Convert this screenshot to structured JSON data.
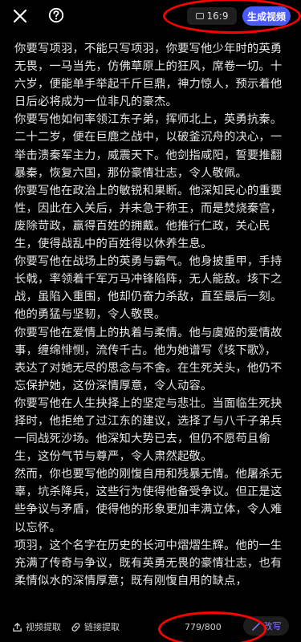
{
  "header": {
    "aspect_ratio": "16:9",
    "generate_label": "生成视频"
  },
  "editor": {
    "content": "你要写项羽，不能只写项羽，你要写他少年时的英勇无畏，一马当先，仿佛草原上的狂风，席卷一切。十六岁，便能单手举起千斤巨鼎，神力惊人，预示着他日后必将成为一位非凡的豪杰。\n你要写他如何率领江东子弟，挥师北上，英勇抗秦。二十二岁，便在巨鹿之战中，以破釜沉舟的决心，一举击溃秦军主力，威震天下。他剑指咸阳，誓要推翻暴秦，恢复六国，那份豪情壮志，令人敬佩。\n你要写他在政治上的敏锐和果断。他深知民心的重要性，因此在入关后，并未急于称王，而是焚烧秦宫，废除苛政，赢得百姓的拥戴。他推行仁政，关心民生，使得战乱中的百姓得以休养生息。\n你要写他在战场上的英勇与霸气。他身披重甲，手持长戟，率领着千军万马冲锋陷阵，无人能敌。垓下之战，虽陷入重围，他却仍奋力杀敌，直至最后一刻。他的勇猛与坚韧，令人敬畏。\n你要写他在爱情上的执着与柔情。他与虞姬的爱情故事，缠绵悱恻，流传千古。他为她谱写《垓下歌》，表达了对她无尽的思念与不舍。在生死关头，他仍不忘保护她，这份深情厚意，令人动容。\n你要写他在人生抉择上的坚定与悲壮。当面临生死抉择时，他拒绝了过江东的建议，选择了与八千子弟兵一同战死沙场。他深知大势已去，但仍不愿苟且偷生，这份气节与尊严，令人肃然起敬。\n然而，你也要写他的刚愎自用和残暴无情。他屠杀无辜，坑杀降兵，这些行为使得他备受争议。但正是这些争议与矛盾，使得他的形象更加丰满立体，令人难以忘怀。\n项羽，这个名字在历史的长河中熠熠生辉。他的一生充满了传奇与争议，既有英勇无畏的豪情壮志，也有柔情似水的深情厚意；既有刚愎自用的缺点，"
  },
  "footer": {
    "video_extract_label": "视频提取",
    "link_extract_label": "链接提取",
    "char_count": "779/800",
    "rewrite_label": "改写"
  },
  "colors": {
    "accent": "#4a5cf7",
    "rewrite_accent": "#8a7dff",
    "highlight": "#ff0000"
  },
  "icons": [
    "close-icon",
    "help-icon",
    "aspect-ratio-icon",
    "video-extract-icon",
    "link-icon",
    "magic-wand-icon"
  ]
}
